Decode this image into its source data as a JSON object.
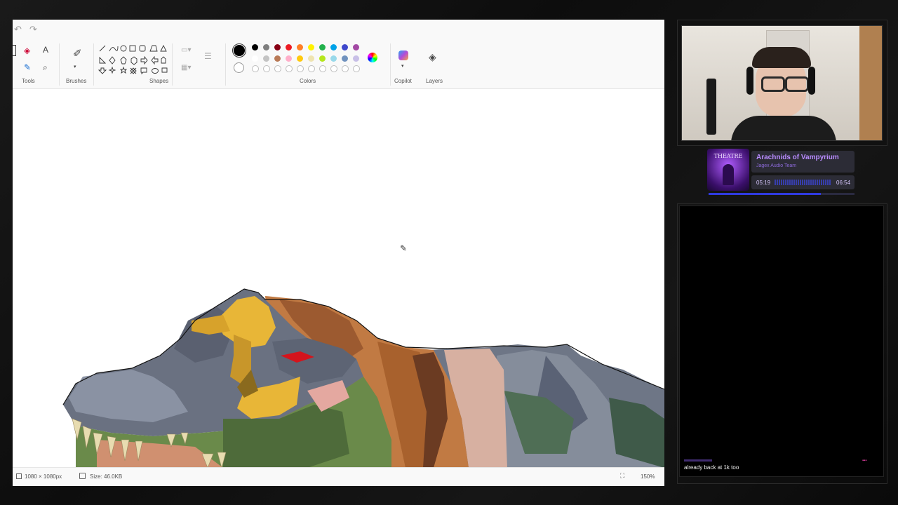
{
  "toolbar": {
    "groups": {
      "tools": "Tools",
      "brushes": "Brushes",
      "shapes": "Shapes",
      "colors": "Colors",
      "copilot": "Copilot",
      "layers": "Layers"
    },
    "palette_row1": [
      "#000000",
      "#7f7f7f",
      "#880015",
      "#ed1c24",
      "#ff7f27",
      "#fff200",
      "#22b14c",
      "#00a2e8",
      "#3f48cc",
      "#a349a4"
    ],
    "palette_row2": [
      "#ffffff",
      "#c3c3c3",
      "#b97a57",
      "#ffaec9",
      "#ffc90e",
      "#efe4b0",
      "#b5e61d",
      "#99d9ea",
      "#7092be",
      "#c8bfe7"
    ],
    "active_color": "#000000",
    "secondary_color": "#ffffff"
  },
  "status": {
    "canvas_size": "1080 × 1080px",
    "file_size": "Size: 46.0KB",
    "zoom": "150%"
  },
  "now_playing": {
    "album_art_text": "THEATRE",
    "title": "Arachnids of Vampyrium",
    "artist": "Jagex Audio Team",
    "elapsed": "05:19",
    "duration": "06:54",
    "progress": 0.77,
    "accent": "#7a3cff"
  },
  "chat": {
    "message": "already back at 1k too"
  }
}
